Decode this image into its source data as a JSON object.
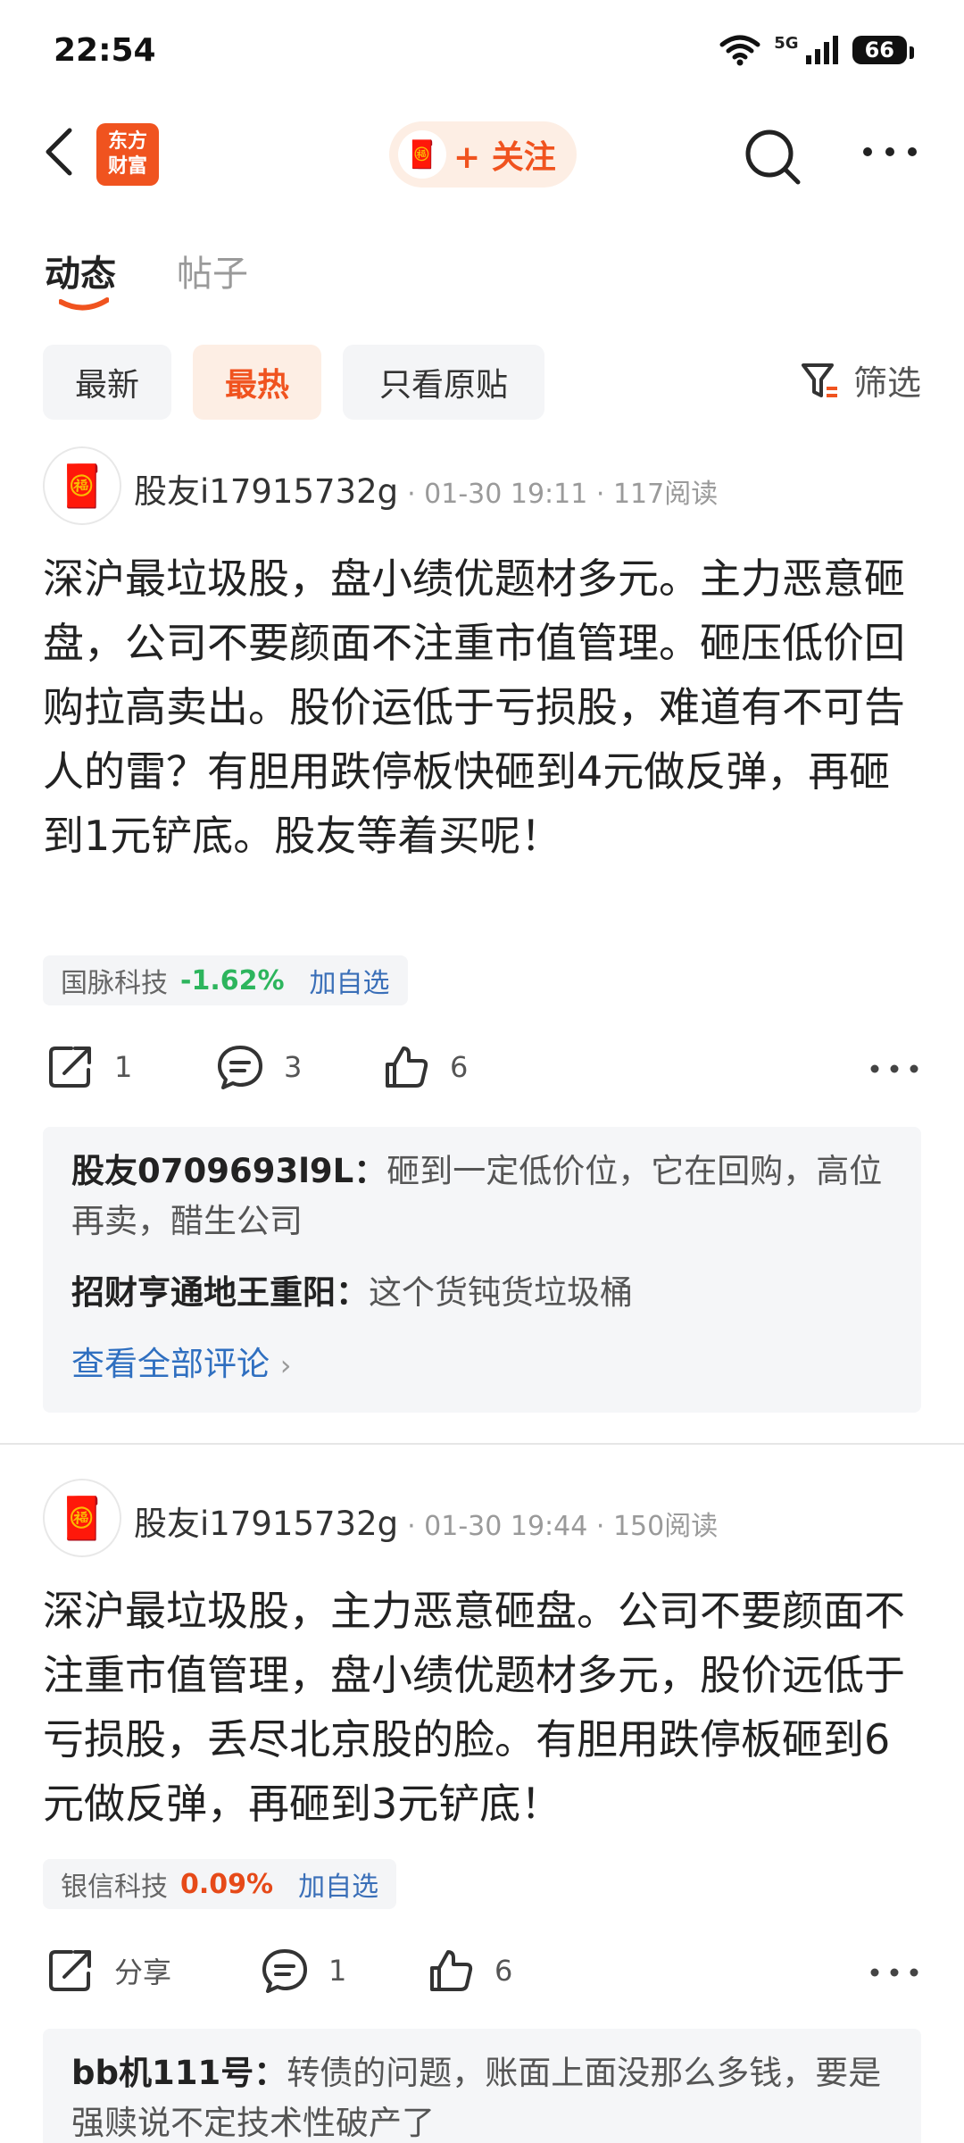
{
  "status_bar": {
    "time": "22:54",
    "network": "5G",
    "battery": "66"
  },
  "header": {
    "logo_line1": "东方",
    "logo_line2": "财富",
    "follow_label": "+ 关注"
  },
  "tabs": [
    {
      "label": "动态"
    },
    {
      "label": "帖子"
    }
  ],
  "filters": [
    {
      "label": "最新"
    },
    {
      "label": "最热"
    },
    {
      "label": "只看原贴"
    }
  ],
  "filter_button": "筛选",
  "posts": [
    {
      "user": "股友i17915732g",
      "meta": "· 01-30 19:11 · 117阅读",
      "text": "深沪最垃圾股，盘小绩优题材多元。主力恶意砸盘，公司不要颜面不注重市值管理。砸压低价回购拉高卖出。股价运低于亏损股，难道有不可告人的雷？有胆用跌停板快砸到4元做反弹，再砸到1元铲底。股友等着买呢！",
      "stock": {
        "name": "国脉科技",
        "change": "-1.62%",
        "add": "加自选"
      },
      "share": "1",
      "comments": "3",
      "likes": "6",
      "replies": [
        {
          "user": "股友0709693l9L：",
          "text": "砸到一定低价位，它在回购，高位再卖，醋生公司"
        },
        {
          "user": "招财亨通地王重阳：",
          "text": "这个货钝货垃圾桶"
        }
      ],
      "view_all": "查看全部评论"
    },
    {
      "user": "股友i17915732g",
      "meta": "· 01-30 19:44 · 150阅读",
      "text": "深沪最垃圾股，主力恶意砸盘。公司不要颜面不注重市值管理，盘小绩优题材多元，股价远低于亏损股，丢尽北京股的脸。有胆用跌停板砸到6元做反弹，再砸到3元铲底！",
      "stock": {
        "name": "银信科技",
        "change": "0.09%",
        "add": "加自选"
      },
      "share": "分享",
      "comments": "1",
      "likes": "6",
      "replies": [
        {
          "user": "bb机111号：",
          "text": "转债的问题，账面上面没那么多钱，要是强赎说不定技术性破产了"
        }
      ]
    }
  ]
}
